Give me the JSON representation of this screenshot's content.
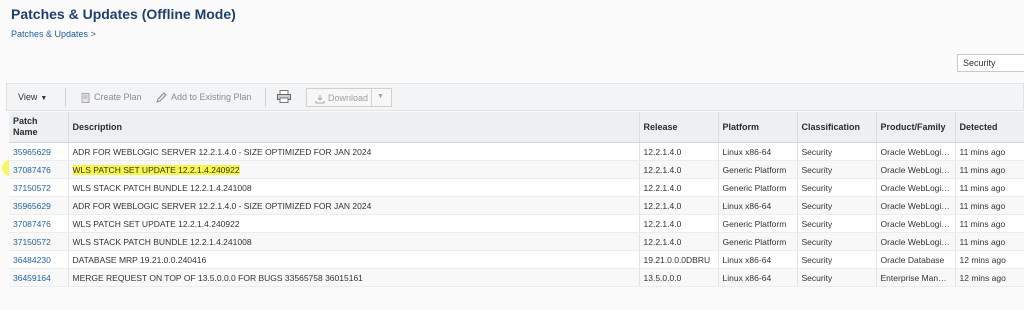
{
  "header": {
    "title": "Patches & Updates (Offline Mode)",
    "breadcrumb": "Patches & Updates >"
  },
  "filter": {
    "value": "Security"
  },
  "toolbar": {
    "view_label": "View",
    "create_plan": "Create Plan",
    "add_to_existing_plan": "Add to Existing Plan",
    "download": "Download"
  },
  "table": {
    "headers": {
      "patch_name": "Patch Name",
      "description": "Description",
      "release": "Release",
      "platform": "Platform",
      "classification": "Classification",
      "product_family": "Product/Family",
      "detected": "Detected"
    },
    "rows": [
      {
        "patch": "35965629",
        "description": "ADR FOR WEBLOGIC SERVER 12.2.1.4.0 - SIZE OPTIMIZED FOR JAN 2024",
        "release": "12.2.1.4.0",
        "platform": "Linux x86-64",
        "classification": "Security",
        "product": "Oracle WebLogi…",
        "detected": "11 mins ago"
      },
      {
        "patch": "37087476",
        "description": "WLS PATCH SET UPDATE 12.2.1.4.240922",
        "release": "12.2.1.4.0",
        "platform": "Generic Platform",
        "classification": "Security",
        "product": "Oracle WebLogi…",
        "detected": "11 mins ago"
      },
      {
        "patch": "37150572",
        "description": "WLS STACK PATCH BUNDLE 12.2.1.4.241008",
        "release": "12.2.1.4.0",
        "platform": "Generic Platform",
        "classification": "Security",
        "product": "Oracle WebLogi…",
        "detected": "11 mins ago"
      },
      {
        "patch": "35965629",
        "description": "ADR FOR WEBLOGIC SERVER 12.2.1.4.0 - SIZE OPTIMIZED FOR JAN 2024",
        "release": "12.2.1.4.0",
        "platform": "Linux x86-64",
        "classification": "Security",
        "product": "Oracle WebLogi…",
        "detected": "11 mins ago"
      },
      {
        "patch": "37087476",
        "description": "WLS PATCH SET UPDATE 12.2.1.4.240922",
        "release": "12.2.1.4.0",
        "platform": "Generic Platform",
        "classification": "Security",
        "product": "Oracle WebLogi…",
        "detected": "11 mins ago"
      },
      {
        "patch": "37150572",
        "description": "WLS STACK PATCH BUNDLE 12.2.1.4.241008",
        "release": "12.2.1.4.0",
        "platform": "Generic Platform",
        "classification": "Security",
        "product": "Oracle WebLogi…",
        "detected": "11 mins ago"
      },
      {
        "patch": "36484230",
        "description": "DATABASE MRP 19.21.0.0.240416",
        "release": "19.21.0.0.0DBRU",
        "platform": "Linux x86-64",
        "classification": "Security",
        "product": "Oracle Database",
        "detected": "12 mins ago"
      },
      {
        "patch": "36459164",
        "description": "MERGE REQUEST ON TOP OF 13.5.0.0.0 FOR BUGS 33565758 36015161",
        "release": "13.5.0.0.0",
        "platform": "Linux x86-64",
        "classification": "Security",
        "product": "Enterprise Man…",
        "detected": "12 mins ago"
      }
    ]
  },
  "colors": {
    "title": "#1e3f70",
    "link": "#2262a8",
    "highlight": "#f7f44a"
  }
}
